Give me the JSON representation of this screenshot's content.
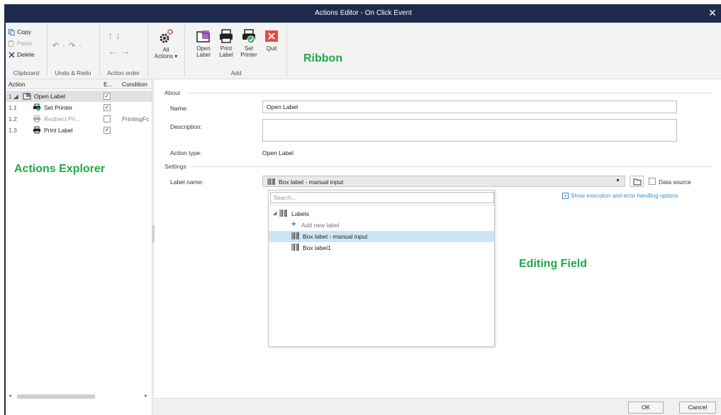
{
  "window": {
    "title": "Actions Editor - On Click Event",
    "close_glyph": "✕"
  },
  "ribbon": {
    "clipboard": {
      "copy": "Copy",
      "paste": "Paste",
      "delete": "Delete",
      "group_label": "Clipboard"
    },
    "undo_redo": {
      "undo_glyph": "↶ ·",
      "redo_glyph": "↷ ·",
      "group_label": "Undo & Redo"
    },
    "action_order": {
      "up_down": "↑↓",
      "left_right": "←→",
      "group_label": "Action order"
    },
    "all_actions": {
      "line1": "All",
      "line2": "Actions ▾"
    },
    "add": {
      "open_label": [
        "Open",
        "Label"
      ],
      "print_label": [
        "Print",
        "Label"
      ],
      "set_printer": [
        "Set",
        "Printer"
      ],
      "quit": "Quit",
      "group_label": "Add"
    },
    "callout": "Ribbon"
  },
  "explorer": {
    "headers": {
      "action": "Action",
      "enabled": "E...",
      "condition": "Condition"
    },
    "rows": [
      {
        "num": "1 ◢",
        "name": "Open Label",
        "checked": "✓",
        "condition": ""
      },
      {
        "num": "1.1",
        "name": "Set Printer",
        "checked": "✓",
        "condition": ""
      },
      {
        "num": "1.2",
        "name": "Redirect Pri...",
        "checked": "",
        "condition": "PrintingFc"
      },
      {
        "num": "1.3",
        "name": "Print Label",
        "checked": "✓",
        "condition": ""
      }
    ],
    "callout": "Actions Explorer",
    "scroll_left": "◂",
    "scroll_right": "▸"
  },
  "editor": {
    "about_title": "About",
    "name_label": "Name:",
    "name_value": "Open Label",
    "description_label": "Description:",
    "description_value": "",
    "action_type_label": "Action type:",
    "action_type_value": "Open Label",
    "settings_title": "Settings",
    "label_name_label": "Label name:",
    "label_name_value": "Box label - manual input",
    "combo_arrow": "▼",
    "data_source_label": "Data source",
    "show_options": "Show execution and error handling options",
    "dropdown": {
      "search_placeholder": "Search...",
      "root": "Labels",
      "root_toggle": "◢",
      "add_new": "Add new label",
      "items": [
        "Box label - manual input",
        "Box label1"
      ]
    },
    "callout": "Editing Field"
  },
  "footer": {
    "ok": "OK",
    "cancel": "Cancel"
  },
  "colors": {
    "titlebar": "#1d2c4c",
    "callout": "#21a84b",
    "link": "#3b8fd6",
    "selection": "#cde6f5"
  }
}
